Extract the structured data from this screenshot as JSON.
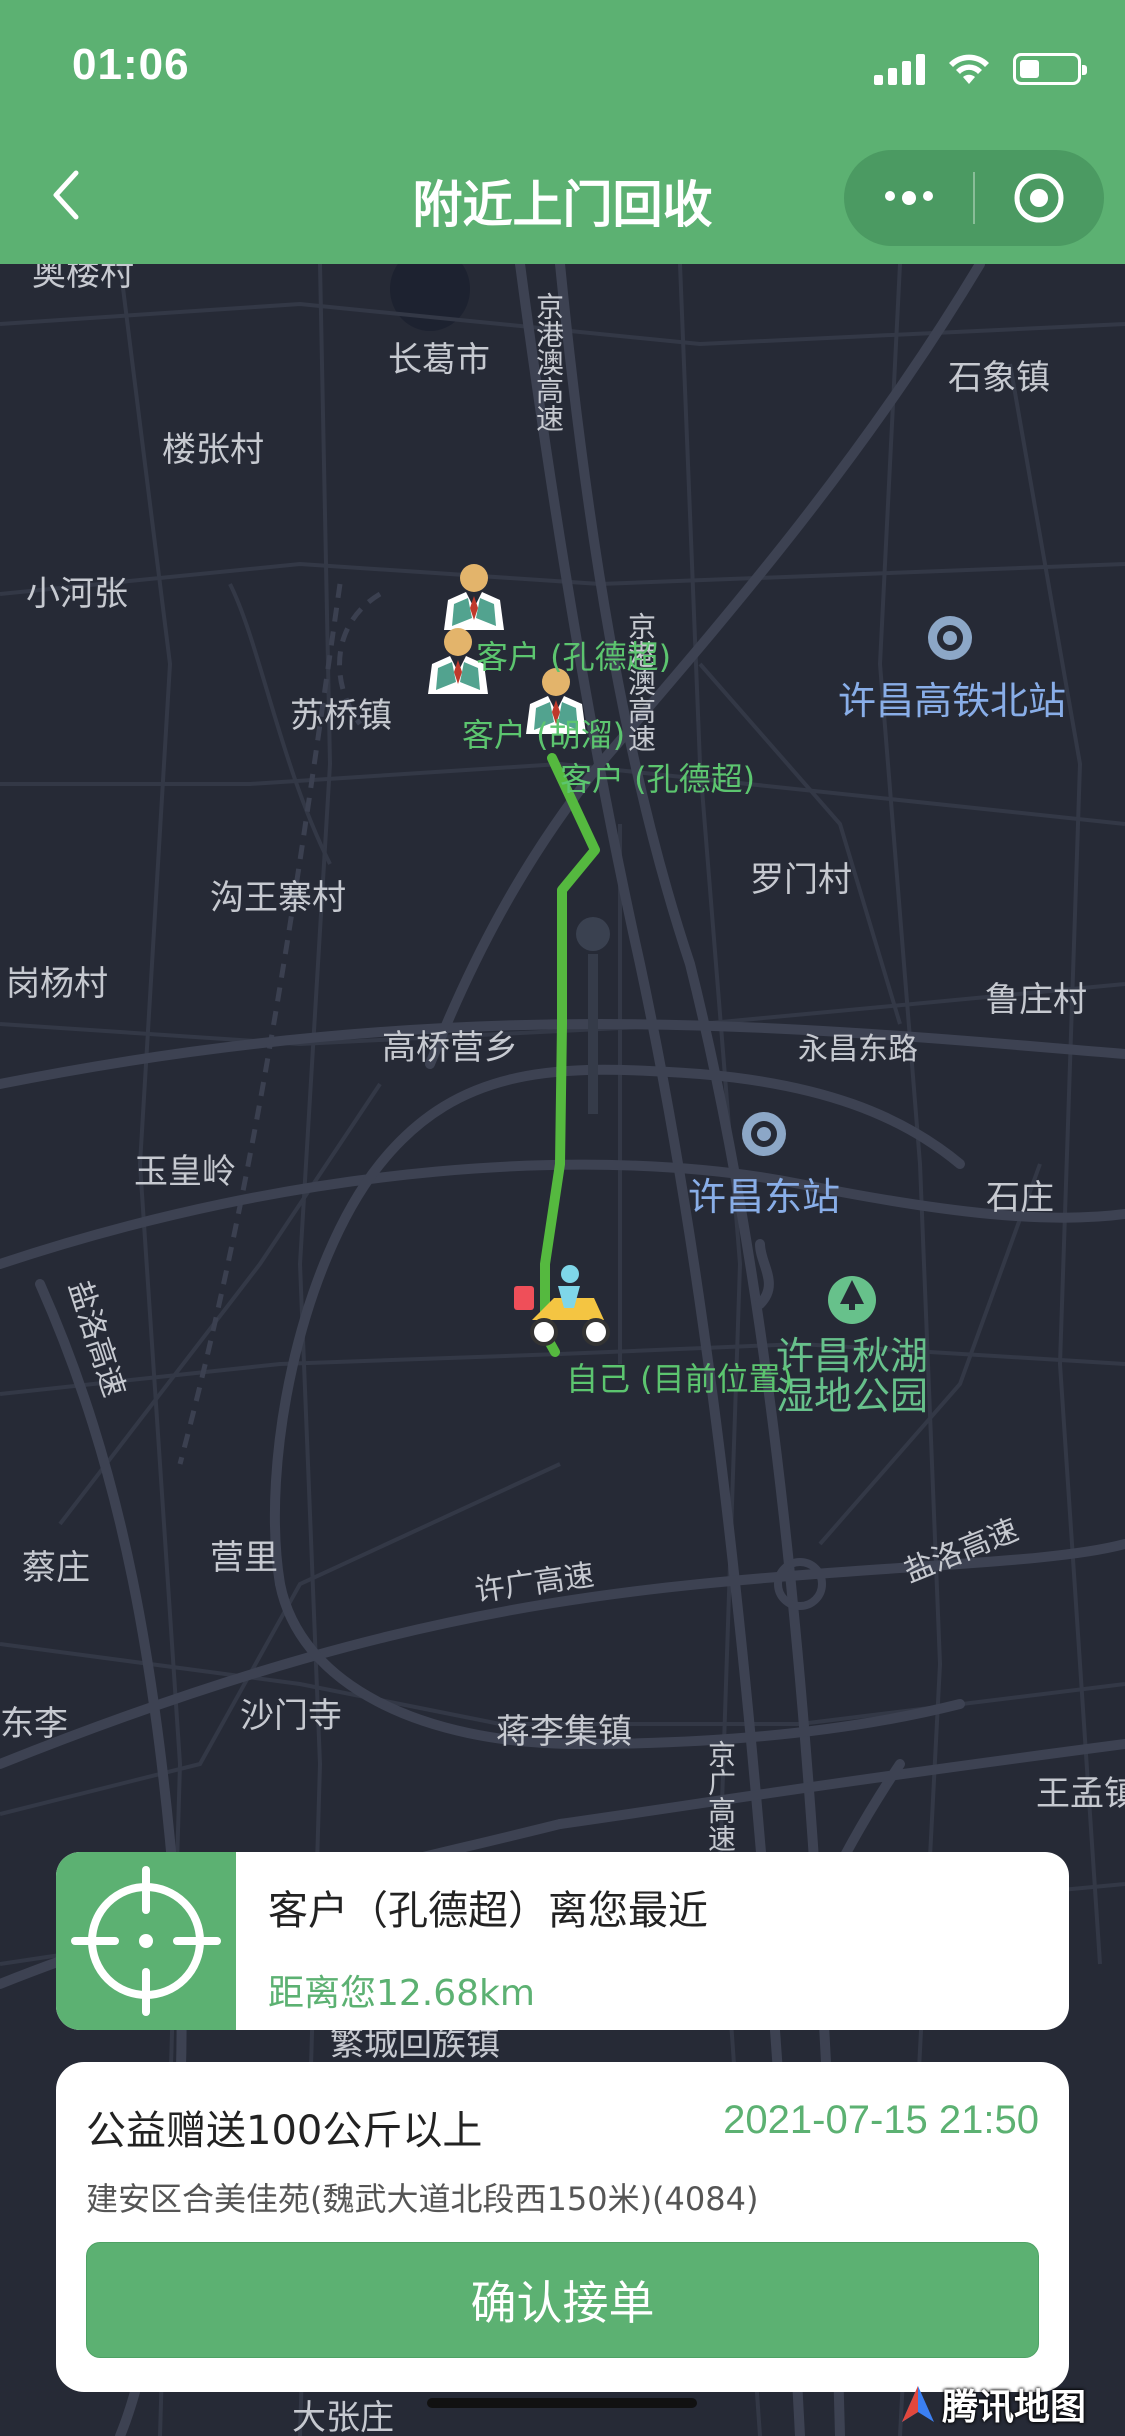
{
  "status_bar": {
    "time": "01:06",
    "battery_level": 0.35
  },
  "nav": {
    "title": "附近上门回收",
    "back_icon": "chevron-left-icon",
    "more_icon": "more-dots-icon",
    "close_icon": "target-circle-icon"
  },
  "map": {
    "labels": [
      "奥楼村",
      "长葛市",
      "京港澳高速",
      "石象镇",
      "楼张村",
      "小河张",
      "苏桥镇",
      "京港澳高速",
      "许昌高铁北站",
      "沟王寨村",
      "罗门村",
      "岗杨村",
      "鲁庄村",
      "高桥营乡",
      "永昌东路",
      "玉皇岭",
      "许昌东站",
      "石庄",
      "盐洛高速",
      "许昌秋湖湿地公园",
      "蔡庄",
      "营里",
      "许广高速",
      "盐洛高速",
      "东李",
      "沙门寺",
      "蒋李集镇",
      "京广高速",
      "王孟镇",
      "繁城回族镇",
      "大张庄"
    ],
    "markers": [
      {
        "label": "客户 (孔德超)",
        "type": "customer"
      },
      {
        "label": "客户 (胡溜)",
        "type": "customer"
      },
      {
        "label": "客户 (孔德超)",
        "type": "customer"
      },
      {
        "label": "自己 (目前位置)",
        "type": "self"
      }
    ],
    "attribution": "腾讯地图"
  },
  "nearest": {
    "title": "客户（孔德超）离您最近",
    "distance": "距离您12.68km",
    "icon": "crosshair-icon"
  },
  "order": {
    "title": "公益赠送100公斤以上",
    "time": "2021-07-15 21:50",
    "address": "建安区合美佳苑(魏武大道北段西150米)(4084)",
    "confirm_label": "确认接单"
  },
  "colors": {
    "brand": "#5cb172",
    "route": "#55b93f",
    "map_bg": "#262a36",
    "road": "#3a3f4e"
  }
}
